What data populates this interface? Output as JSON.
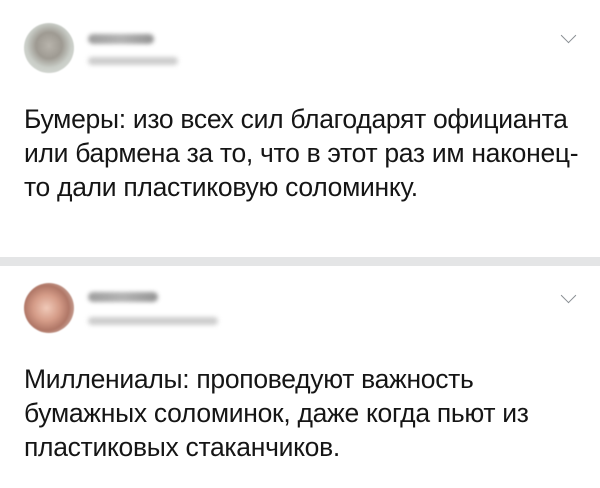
{
  "posts": [
    {
      "avatar_icon": "user-avatar-blurred",
      "author_name": "",
      "author_handle": "",
      "menu_icon": "chevron-down-icon",
      "text": "Бумеры: изо всех сил благодарят официанта или бармена за то, что в этот раз им наконец-то дали пластиковую соломинку."
    },
    {
      "avatar_icon": "user-avatar-blurred",
      "author_name": "",
      "author_handle": "",
      "menu_icon": "chevron-down-icon",
      "text": "Миллениалы: проповедуют важность бумажных соломинок, даже когда пьют из пластиковых стаканчиков."
    }
  ],
  "colors": {
    "background": "#e4e5e6",
    "card": "#ffffff",
    "text": "#151515",
    "icon": "#8a8f94"
  }
}
